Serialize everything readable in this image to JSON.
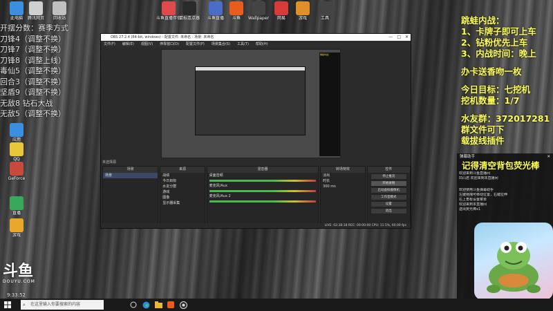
{
  "desktop": {
    "icons": [
      {
        "label": "此电脑",
        "color": "#3c8fe0"
      },
      {
        "label": "腾讯网页",
        "color": "#d0d0d0"
      },
      {
        "label": "回收站",
        "color": "#c0c0c0"
      },
      {
        "label": "斗鱼直播伴侣",
        "color": "#e04a4a"
      },
      {
        "label": "鼠标连点器",
        "color": "#2a2a2a"
      },
      {
        "label": "斗鱼直播",
        "color": "#4a6ec8"
      },
      {
        "label": "斗鱼",
        "color": "#e85c1c"
      },
      {
        "label": "Wallpaper",
        "color": "#444444"
      },
      {
        "label": "网易",
        "color": "#d83a3a"
      },
      {
        "label": "游戏",
        "color": "#e0902a"
      },
      {
        "label": "工具",
        "color": "#444444"
      }
    ],
    "left_icons": [
      {
        "label": "应用",
        "color": "#3c8fe0"
      },
      {
        "label": "QQ",
        "color": "#e8c83a"
      },
      {
        "label": "GeForce",
        "color": "#c84a3a"
      },
      {
        "label": "直播",
        "color": "#3aa85a"
      },
      {
        "label": "游戏",
        "color": "#e8a82a"
      }
    ]
  },
  "left_overlay": {
    "lines": [
      "开摆分数：赛季方式",
      "刀锋4（调整不换）",
      "刀锋7（调整不换）",
      "刀锋8（调整上线）",
      "毒仙5（调整不换）",
      "回合3（调整不换）",
      "坚盾9（调整不换）",
      "无敌8 钻石大战",
      "无敌5（调整不换）"
    ]
  },
  "right_overlay": {
    "lines": [
      "跳蛙内战：",
      "1、卡牌子即可上车",
      "2、钻粉优先上车",
      "3、内战时间：晚上",
      "",
      "办卡送香吻一枚",
      "",
      "今日目标：七挖机",
      "挖机数量：1/7",
      "",
      "水友群：372017281",
      "群文件可下",
      "载拔线插件"
    ]
  },
  "obs": {
    "title": "OBS 27.2.4 (64-bit, windows) - 配置文件: 未命名 - 场景: 未命名",
    "menu": [
      "文件(F)",
      "编辑(E)",
      "视图(V)",
      "停靠窗口(D)",
      "配置文件(P)",
      "场景集合(S)",
      "工具(T)",
      "帮助(H)"
    ],
    "docks": {
      "scenes": {
        "title": "场景",
        "items": [
          "场景"
        ]
      },
      "sources": {
        "title": "来源",
        "items": [
          "战绩",
          "今日目标",
          "水友分群",
          "游戏",
          "图像",
          "显示器采集"
        ]
      },
      "mixer": {
        "title": "混音器",
        "tracks": [
          "桌面音频",
          "麦克风/Aux",
          "麦克风/Aux 2"
        ],
        "levels": [
          0.55,
          0.6,
          0.45
        ]
      },
      "transitions": {
        "title": "转场特效",
        "type": "淡出",
        "duration_label": "时长",
        "duration": "300 ms"
      },
      "controls": {
        "title": "控件",
        "buttons": [
          "停止推流",
          "开始录制",
          "启动虚拟摄像机",
          "工作室模式",
          "设置",
          "退出"
        ]
      }
    },
    "scene_panel_label": "未选择源",
    "status": "LIVE: 02:38:18   REC: 00:00:00   CPU: 11.5%, 60.00 fps"
  },
  "chat": {
    "header": "弹幕助手",
    "reminder": "记得清空背包荧光棒",
    "lines": [
      "欢迎来到斗鱼直播间",
      "凹凸君 欢迎来到本直播间",
      "欢迎使用斗鱼弹幕助手",
      "左键拖拽可移动位置，右键拉伸",
      "右上角有设置菜单",
      "欢迎来到本直播间",
      "送出荧光棒x1"
    ]
  },
  "douyu": {
    "mark": "斗鱼",
    "sub": "DOUYU.COM"
  },
  "clock": "9:33:52",
  "taskbar": {
    "search_placeholder": "在这里输入你要搜索的内容",
    "icons": [
      "task-view-icon",
      "edge-icon",
      "explorer-icon",
      "douyu-icon",
      "obs-icon"
    ]
  }
}
